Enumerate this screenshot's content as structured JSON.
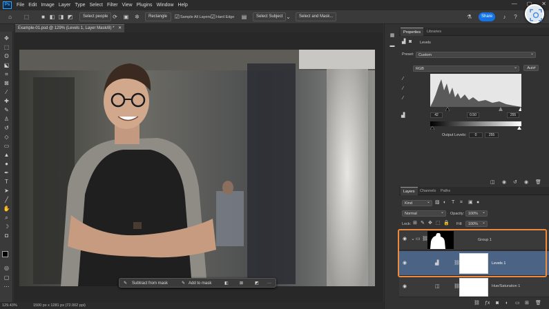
{
  "menubar": {
    "logo": "Ps",
    "items": [
      "File",
      "Edit",
      "Image",
      "Layer",
      "Type",
      "Select",
      "Filter",
      "View",
      "Plugins",
      "Window",
      "Help"
    ],
    "window_controls": [
      "—",
      "▢",
      "✕"
    ]
  },
  "options": {
    "select_people": "Select people",
    "mode": "Rectangle",
    "sample_all_layers": "Sample All Layers",
    "hard_edge": "Hard Edge",
    "select_subject": "Select Subject",
    "select_and_mask": "Select and Mask...",
    "share": "Share"
  },
  "document": {
    "tab_title": "Example-01.psd @ 129% (Levels 1, Layer Mask/8) *",
    "tab_close": "✕"
  },
  "mask_toolbar": {
    "subtract": "Subtract from mask",
    "add": "Add to mask",
    "more": "···"
  },
  "status": {
    "zoom": "129.43%",
    "size": "1500 px x 1281 px (72.002 ppi)"
  },
  "properties": {
    "tabs": [
      "Properties",
      "Libraries"
    ],
    "adjustment": "Levels",
    "preset_label": "Preset:",
    "preset_value": "Custom",
    "channel": "RGB",
    "auto": "Auto",
    "input_levels": [
      "42",
      "0.50",
      "255"
    ],
    "output_label": "Output Levels:",
    "output_levels": [
      "0",
      "255"
    ]
  },
  "layers": {
    "tabs": [
      "Layers",
      "Channels",
      "Paths"
    ],
    "kind": "Kind",
    "blend_mode": "Normal",
    "opacity_label": "Opacity:",
    "opacity": "100%",
    "lock_label": "Lock:",
    "fill_label": "Fill:",
    "fill": "100%",
    "items": [
      {
        "name": "Group 1"
      },
      {
        "name": "Levels 1"
      },
      {
        "name": "Hue/Saturation 1"
      }
    ]
  },
  "colors": {
    "accent": "#1473e6",
    "highlight": "#f08a3c",
    "selected_layer": "#4b6385"
  }
}
